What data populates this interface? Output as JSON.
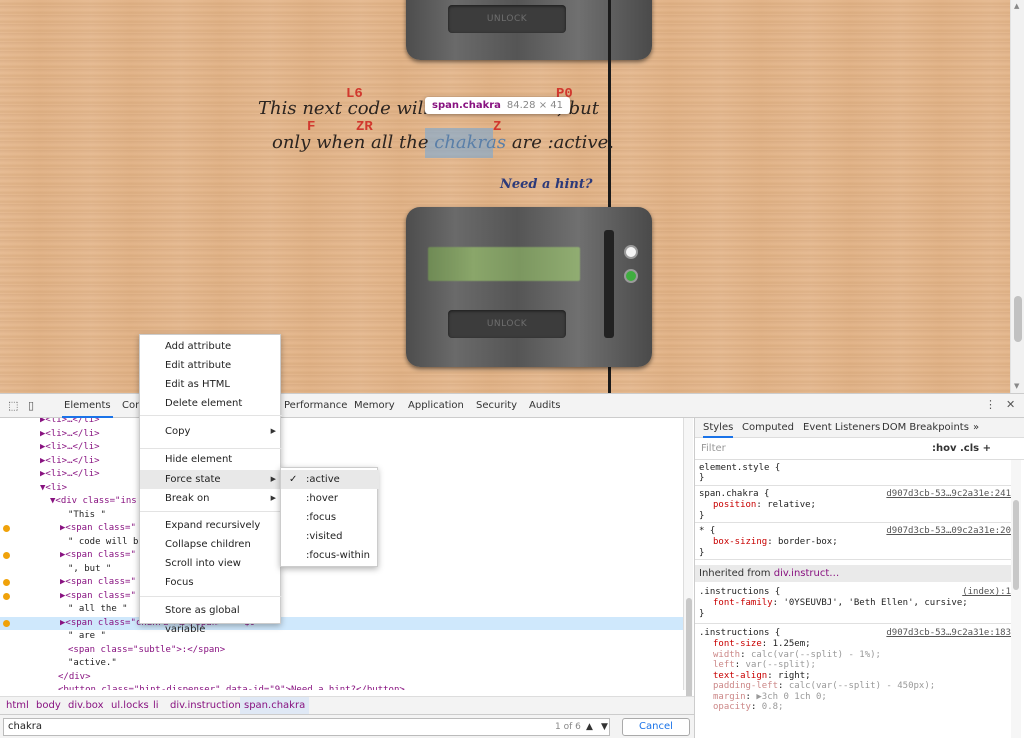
{
  "page": {
    "unlock_top": "UNLOCK",
    "unlock_bottom": "UNLOCK",
    "instructions": {
      "line1_start": "This next code will",
      "line1_end": ", but",
      "line2_start": "only when all the",
      "chakras": "chakras",
      "line2_end": "are :active."
    },
    "markers": {
      "l6": "L6",
      "p0": "P0",
      "f": "F",
      "zr": "ZR",
      "z": "Z"
    },
    "hint_link": "Need a hint?",
    "tooltip": {
      "tag": "span.chakra",
      "dims": "84.28 × 41"
    },
    "led_colors": {
      "white": "#f4f4f4",
      "green": "#3fae3f"
    }
  },
  "devtools": {
    "tabs": [
      "Elements",
      "Con",
      "Performance",
      "Memory",
      "Application",
      "Security",
      "Audits"
    ],
    "more_tabs": "»",
    "menu_dots": "⋮",
    "close": "✕",
    "dom_rows": [
      {
        "text": "▶<li>…</li>",
        "dot": false,
        "indent": 40
      },
      {
        "text": "▶<li>…</li>",
        "dot": false,
        "indent": 40
      },
      {
        "text": "▶<li>…</li>",
        "dot": false,
        "indent": 40
      },
      {
        "text": "▶<li>…</li>",
        "dot": false,
        "indent": 40
      },
      {
        "text": "▶<li>…</li>",
        "dot": false,
        "indent": 40
      },
      {
        "text": "▼<li>",
        "dot": false,
        "indent": 40
      },
      {
        "text": "▼<div class=\"ins",
        "dot": false,
        "indent": 50
      },
      {
        "text": "\"This \"",
        "dot": false,
        "indent": 68,
        "plain": true
      },
      {
        "text": "▶<span class=\"",
        "dot": true,
        "indent": 60
      },
      {
        "text": "\" code will b",
        "dot": false,
        "indent": 68,
        "plain": true
      },
      {
        "text": "▶<span class=\"",
        "dot": true,
        "indent": 60
      },
      {
        "text": "\", but \"",
        "dot": false,
        "indent": 68,
        "plain": true
      },
      {
        "text": "▶<span class=\"",
        "dot": true,
        "indent": 60
      },
      {
        "text": "▶<span class=\"",
        "dot": true,
        "indent": 60
      },
      {
        "text": "\" all the \"",
        "dot": false,
        "indent": 68,
        "plain": true
      },
      {
        "text": "▶<span class=\"chakra\">…</span> == $0",
        "dot": true,
        "indent": 60,
        "selected": true
      },
      {
        "text": "\" are \"",
        "dot": false,
        "indent": 68,
        "plain": true
      },
      {
        "text": "<span class=\"subtle\">:</span>",
        "dot": false,
        "indent": 68
      },
      {
        "text": "\"active.\"",
        "dot": false,
        "indent": 68,
        "plain": true
      },
      {
        "text": "</div>",
        "dot": false,
        "indent": 58
      },
      {
        "text": "<button class=\"hint-dispenser\" data-id=\"9\">Need a hint?</button>",
        "dot": false,
        "indent": 58
      }
    ],
    "breadcrumb": [
      "html",
      "body",
      "div.box",
      "ul.locks",
      "li",
      "div.instructions",
      "span.chakra"
    ],
    "search": {
      "value": "chakra",
      "count": "1 of 6",
      "cancel": "Cancel"
    },
    "styles_tabs": [
      "Styles",
      "Computed",
      "Event Listeners",
      "DOM Breakpoints"
    ],
    "styles_more": "»",
    "filter_placeholder": "Filter",
    "hov_cls": ":hov  .cls  +",
    "rules": {
      "element_style": "element.style {",
      "r1_sel": "span.chakra {",
      "r1_src": "d907d3cb-53…9c2a31e:241",
      "r1_prop": "position",
      "r1_val": "relative;",
      "r2_sel": "* {",
      "r2_src": "d907d3cb-53…09c2a31e:20",
      "r2_prop": "box-sizing",
      "r2_val": "border-box;",
      "inherited_label": "Inherited from",
      "inherited_ref": "div.instruct…",
      "r3_sel": ".instructions {",
      "r3_src": "(index):1",
      "r3_prop": "font-family",
      "r3_val": "'0YSEUVBJ', 'Beth Ellen', cursive;",
      "r4_sel": ".instructions {",
      "r4_src": "d907d3cb-53…9c2a31e:183",
      "r4_props": [
        {
          "p": "font-size",
          "v": "1.25em;",
          "dim": false
        },
        {
          "p": "width",
          "v": "calc(var(--split) - 1%);",
          "dim": true
        },
        {
          "p": "left",
          "v": "var(--split);",
          "dim": true
        },
        {
          "p": "text-align",
          "v": "right;",
          "dim": false
        },
        {
          "p": "padding-left",
          "v": "calc(var(--split) - 450px);",
          "dim": true
        },
        {
          "p": "margin",
          "v": "▶3ch 0 1ch 0;",
          "dim": true
        },
        {
          "p": "opacity",
          "v": "0.8;",
          "dim": true
        }
      ],
      "close_brace": "}"
    },
    "context_menu": [
      "Add attribute",
      "Edit attribute",
      "Edit as HTML",
      "Delete element",
      "Copy",
      "Hide element",
      "Force state",
      "Break on",
      "Expand recursively",
      "Collapse children",
      "Scroll into view",
      "Focus",
      "Store as global variable"
    ],
    "submenu": [
      ":active",
      ":hover",
      ":focus",
      ":visited",
      ":focus-within"
    ],
    "submenu_check": "✓"
  }
}
